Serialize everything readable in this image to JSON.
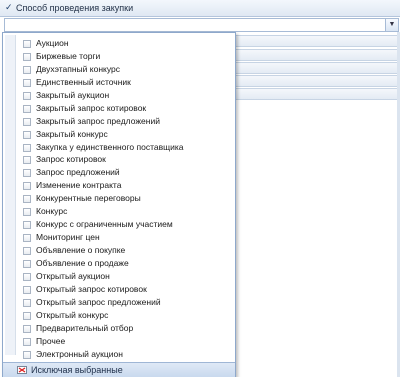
{
  "header": {
    "title": "Способ проведения закупки",
    "check": "✓"
  },
  "combo": {
    "value": "",
    "arrow": "▼"
  },
  "dropdown": {
    "items": [
      "Аукцион",
      "Биржевые торги",
      "Двухэтапный конкурс",
      "Единственный источник",
      "Закрытый аукцион",
      "Закрытый запрос котировок",
      "Закрытый запрос предложений",
      "Закрытый конкурс",
      "Закупка у единственного поставщика",
      "Запрос котировок",
      "Запрос предложений",
      "Изменение контракта",
      "Конкурентные переговоры",
      "Конкурс",
      "Конкурс с ограниченным участием",
      "Мониторинг цен",
      "Объявление о покупке",
      "Объявление о продаже",
      "Открытый аукцион",
      "Открытый запрос котировок",
      "Открытый запрос предложений",
      "Открытый конкурс",
      "Предварительный отбор",
      "Прочее",
      "Электронный аукцион"
    ],
    "footer_label": "Исключая выбранные",
    "footer_icon": "clear-filter-icon"
  }
}
